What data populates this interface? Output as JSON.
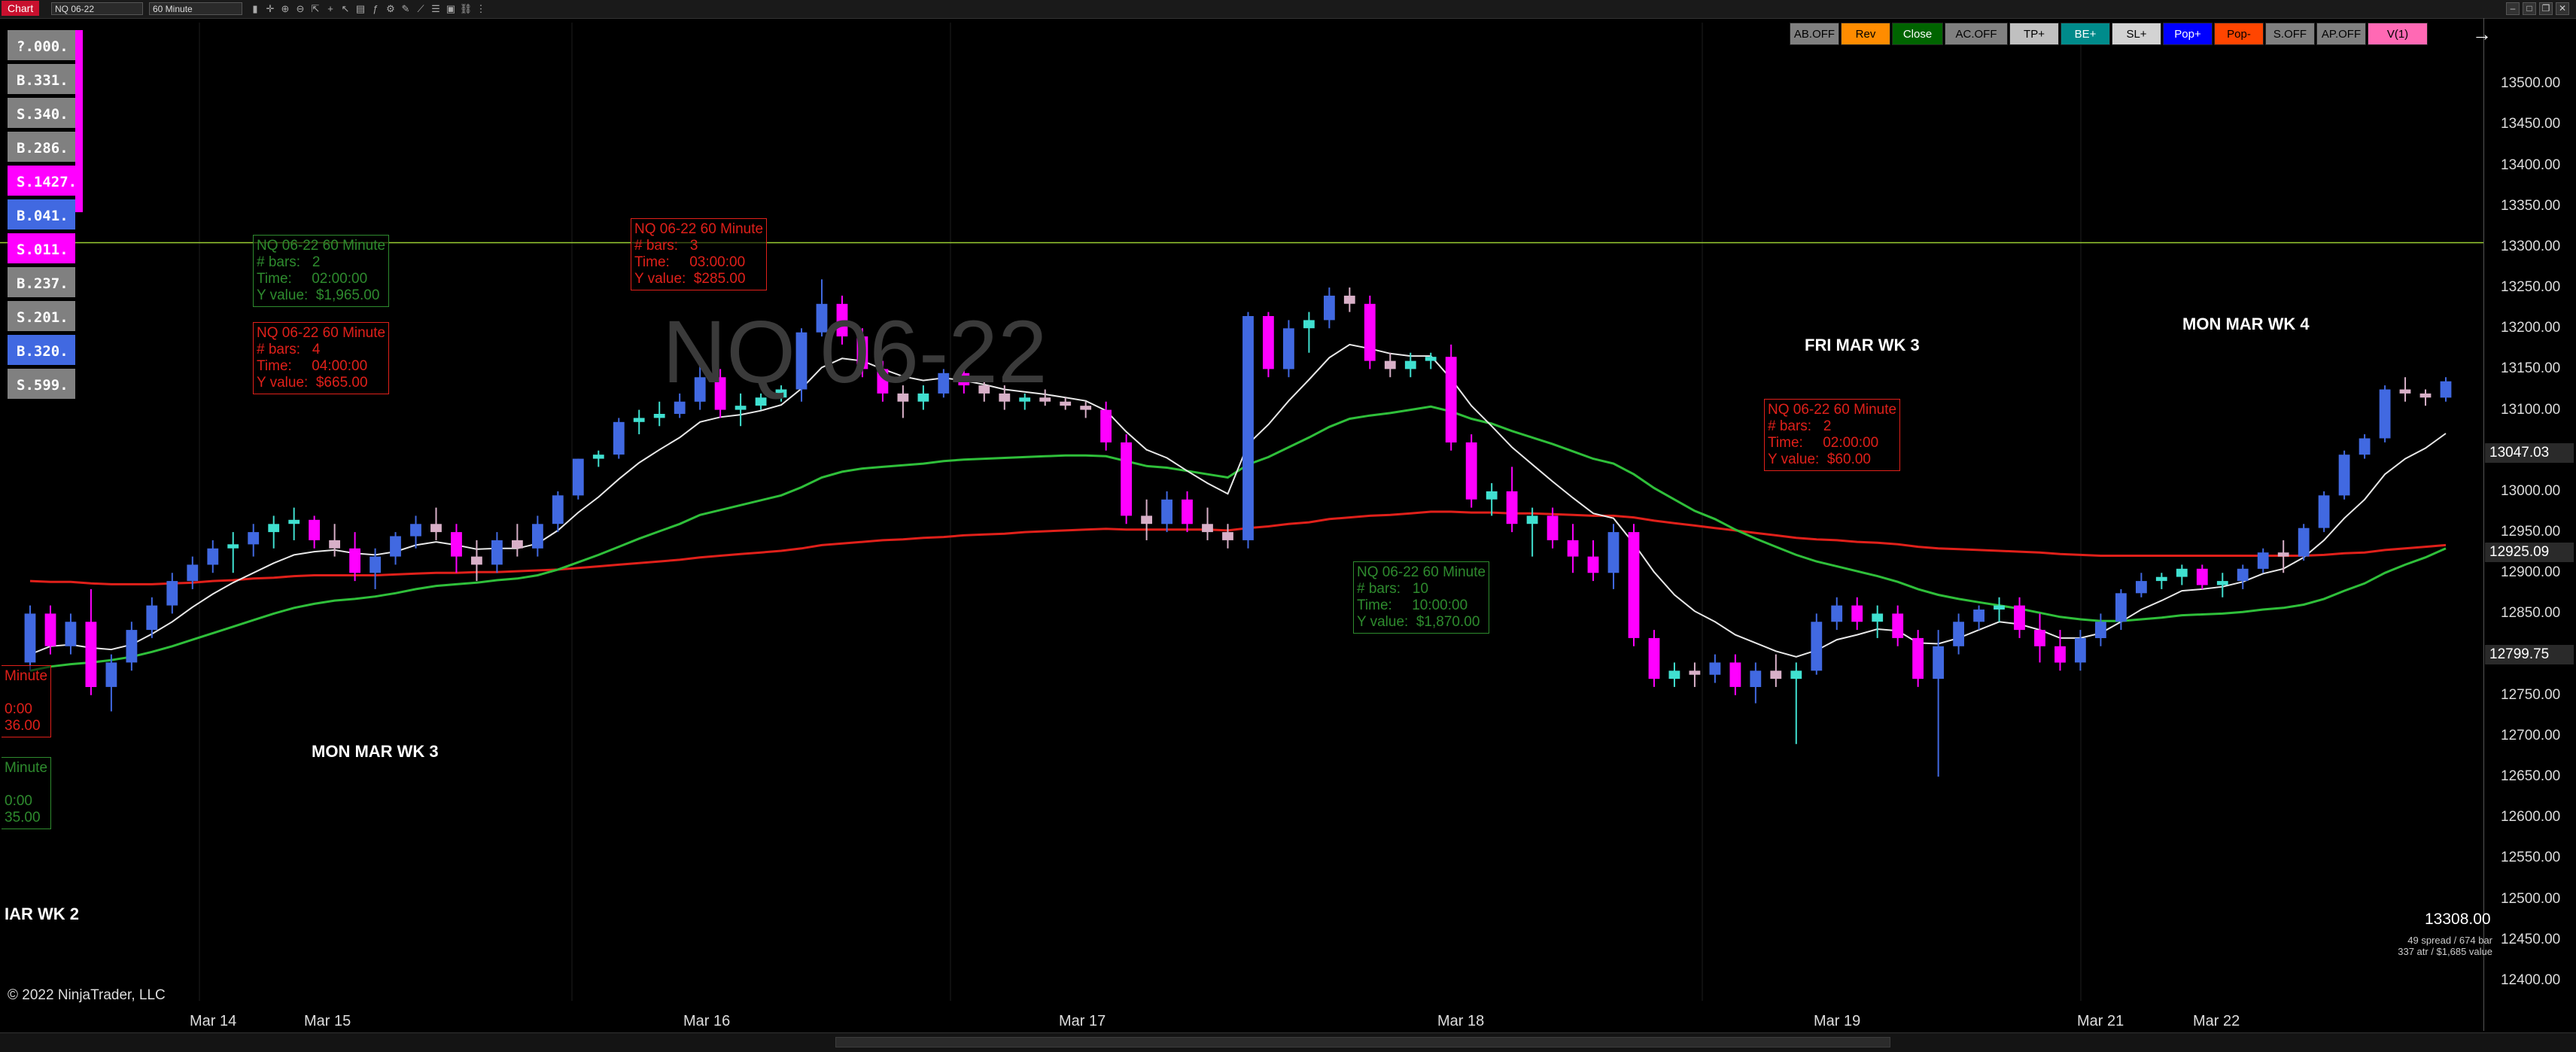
{
  "toolbar": {
    "tab_label": "Chart",
    "instrument": "NQ 06-22",
    "interval": "60 Minute"
  },
  "buttons": [
    {
      "label": "AB.OFF",
      "bg": "#808080",
      "fg": "#000000"
    },
    {
      "label": "Rev",
      "bg": "#ff8c00",
      "fg": "#000000"
    },
    {
      "label": "Close",
      "bg": "#006400",
      "fg": "#ffffff"
    },
    {
      "label": "AC.OFF",
      "bg": "#808080",
      "fg": "#000000"
    },
    {
      "label": "TP+",
      "bg": "#c0c0c0",
      "fg": "#000000"
    },
    {
      "label": "BE+",
      "bg": "#008b8b",
      "fg": "#ffffff"
    },
    {
      "label": "SL+",
      "bg": "#d3d3d3",
      "fg": "#000000"
    },
    {
      "label": "Pop+",
      "bg": "#0000ff",
      "fg": "#ffffff"
    },
    {
      "label": "Pop-",
      "bg": "#ff4500",
      "fg": "#000000"
    },
    {
      "label": "S.OFF",
      "bg": "#808080",
      "fg": "#000000"
    },
    {
      "label": "AP.OFF",
      "bg": "#808080",
      "fg": "#000000"
    },
    {
      "label": "V(1)",
      "bg": "#ff69b4",
      "fg": "#000000"
    }
  ],
  "order_ladder": [
    {
      "label": "?.000.",
      "bg": "#808080"
    },
    {
      "label": "B.331.",
      "bg": "#808080"
    },
    {
      "label": "S.340.",
      "bg": "#808080"
    },
    {
      "label": "B.286.",
      "bg": "#808080"
    },
    {
      "label": "S.1427.",
      "bg": "#ff00ff"
    },
    {
      "label": "B.041.",
      "bg": "#4169e1"
    },
    {
      "label": "S.011.",
      "bg": "#ff00ff"
    },
    {
      "label": "B.237.",
      "bg": "#808080"
    },
    {
      "label": "S.201.",
      "bg": "#808080"
    },
    {
      "label": "B.320.",
      "bg": "#4169e1"
    },
    {
      "label": "S.599.",
      "bg": "#808080"
    }
  ],
  "info_boxes": [
    {
      "lines": [
        "NQ 06-22 60 Minute",
        "# bars:   2",
        "Time:     02:00:00",
        "Y value:  $1,965.00"
      ],
      "color": "#2e8b2e"
    },
    {
      "lines": [
        "NQ 06-22 60 Minute",
        "# bars:   4",
        "Time:     04:00:00",
        "Y value:  $665.00"
      ],
      "color": "#e0201a"
    },
    {
      "lines": [
        "NQ 06-22 60 Minute",
        "# bars:   3",
        "Time:     03:00:00",
        "Y value:  $285.00"
      ],
      "color": "#e0201a"
    },
    {
      "lines": [
        "NQ 06-22 60 Minute",
        "# bars:   10",
        "Time:     10:00:00",
        "Y value:  $1,870.00"
      ],
      "color": "#2e8b2e"
    },
    {
      "lines": [
        "NQ 06-22 60 Minute",
        "# bars:   2",
        "Time:     02:00:00",
        "Y value:  $60.00"
      ],
      "color": "#e0201a"
    },
    {
      "lines": [
        "Minute",
        "",
        "0:00",
        "36.00"
      ],
      "color": "#e0201a"
    },
    {
      "lines": [
        "Minute",
        "",
        "0:00",
        "35.00"
      ],
      "color": "#2e8b2e"
    }
  ],
  "week_labels": [
    "MON MAR WK 3",
    "FRI MAR WK 3",
    "MON MAR WK 4",
    "IAR WK 2"
  ],
  "watermark": "NQ 06-22",
  "copyright": "© 2022 NinjaTrader, LLC",
  "stats": {
    "last_price": "13308.00",
    "line1": "49 spread / 674 bar",
    "line2": "337 atr / $1,685 value"
  },
  "price_flags": [
    {
      "label": "13047.03",
      "bg": "#2a2a2a",
      "fg": "#ffffff",
      "price": 13047.03
    },
    {
      "label": "12925.09",
      "bg": "#2a2a2a",
      "fg": "#ffffff",
      "price": 12925.09
    },
    {
      "label": "12799.75",
      "bg": "#2a2a2a",
      "fg": "#ffffff",
      "price": 12799.75
    }
  ],
  "chart_data": {
    "type": "candlestick",
    "instrument": "NQ 06-22",
    "interval": "60 Minute",
    "ylim": [
      12375,
      13575
    ],
    "y_ticks": [
      13500,
      13450,
      13400,
      13350,
      13300,
      13250,
      13200,
      13150,
      13100,
      13050,
      13000,
      12950,
      12900,
      12850,
      12800,
      12750,
      12700,
      12650,
      12600,
      12550,
      12500,
      12450,
      12400
    ],
    "x_labels": [
      "Mar 14",
      "Mar 15",
      "Mar 16",
      "Mar 17",
      "Mar 18",
      "Mar 19",
      "Mar 21",
      "Mar 22"
    ],
    "colors": {
      "up": "#4169e1",
      "down": "#ff00ff",
      "neutral": "#d8b0c8",
      "cyan": "#40e0d0",
      "ema_fast": "#e8e8e8",
      "ema_mid": "#2fbf3a",
      "ema_slow": "#e0201a",
      "level_line": "#9acd32"
    },
    "level_line": 13305,
    "candles": [
      [
        12790,
        12860,
        12780,
        12850
      ],
      [
        12850,
        12860,
        12800,
        12810
      ],
      [
        12810,
        12850,
        12800,
        12840
      ],
      [
        12840,
        12880,
        12750,
        12760
      ],
      [
        12760,
        12800,
        12730,
        12790
      ],
      [
        12790,
        12840,
        12780,
        12830
      ],
      [
        12830,
        12870,
        12820,
        12860
      ],
      [
        12860,
        12900,
        12850,
        12890
      ],
      [
        12890,
        12920,
        12880,
        12910
      ],
      [
        12910,
        12940,
        12900,
        12930
      ],
      [
        12930,
        12950,
        12900,
        12935
      ],
      [
        12935,
        12960,
        12920,
        12950
      ],
      [
        12950,
        12970,
        12930,
        12960
      ],
      [
        12960,
        12980,
        12940,
        12965
      ],
      [
        12965,
        12970,
        12930,
        12940
      ],
      [
        12940,
        12960,
        12920,
        12930
      ],
      [
        12930,
        12950,
        12890,
        12900
      ],
      [
        12900,
        12930,
        12880,
        12920
      ],
      [
        12920,
        12950,
        12910,
        12945
      ],
      [
        12945,
        12970,
        12930,
        12960
      ],
      [
        12960,
        12980,
        12940,
        12950
      ],
      [
        12950,
        12960,
        12900,
        12920
      ],
      [
        12920,
        12940,
        12890,
        12910
      ],
      [
        12910,
        12950,
        12900,
        12940
      ],
      [
        12940,
        12960,
        12920,
        12930
      ],
      [
        12930,
        12970,
        12920,
        12960
      ],
      [
        12960,
        13000,
        12950,
        12995
      ],
      [
        12995,
        13040,
        12990,
        13040
      ],
      [
        13040,
        13050,
        13030,
        13045
      ],
      [
        13045,
        13090,
        13040,
        13085
      ],
      [
        13085,
        13100,
        13070,
        13090
      ],
      [
        13090,
        13110,
        13080,
        13095
      ],
      [
        13095,
        13120,
        13090,
        13110
      ],
      [
        13110,
        13160,
        13100,
        13140
      ],
      [
        13140,
        13150,
        13090,
        13100
      ],
      [
        13100,
        13120,
        13080,
        13105
      ],
      [
        13105,
        13120,
        13100,
        13115
      ],
      [
        13115,
        13130,
        13110,
        13125
      ],
      [
        13125,
        13200,
        13110,
        13195
      ],
      [
        13195,
        13260,
        13190,
        13230
      ],
      [
        13230,
        13240,
        13180,
        13190
      ],
      [
        13190,
        13200,
        13140,
        13150
      ],
      [
        13150,
        13160,
        13110,
        13120
      ],
      [
        13120,
        13130,
        13090,
        13110
      ],
      [
        13110,
        13130,
        13100,
        13120
      ],
      [
        13120,
        13150,
        13115,
        13145
      ],
      [
        13145,
        13150,
        13120,
        13130
      ],
      [
        13130,
        13140,
        13110,
        13120
      ],
      [
        13120,
        13130,
        13100,
        13110
      ],
      [
        13110,
        13120,
        13100,
        13115
      ],
      [
        13115,
        13125,
        13105,
        13110
      ],
      [
        13110,
        13115,
        13100,
        13105
      ],
      [
        13105,
        13110,
        13090,
        13100
      ],
      [
        13100,
        13110,
        13050,
        13060
      ],
      [
        13060,
        13070,
        12960,
        12970
      ],
      [
        12970,
        12990,
        12940,
        12960
      ],
      [
        12960,
        13000,
        12950,
        12990
      ],
      [
        12990,
        13000,
        12950,
        12960
      ],
      [
        12960,
        12980,
        12940,
        12950
      ],
      [
        12950,
        12960,
        12930,
        12940
      ],
      [
        12940,
        13220,
        12930,
        13215
      ],
      [
        13215,
        13220,
        13140,
        13150
      ],
      [
        13150,
        13210,
        13140,
        13200
      ],
      [
        13200,
        13220,
        13170,
        13210
      ],
      [
        13210,
        13250,
        13200,
        13240
      ],
      [
        13240,
        13250,
        13220,
        13230
      ],
      [
        13230,
        13240,
        13150,
        13160
      ],
      [
        13160,
        13170,
        13140,
        13150
      ],
      [
        13150,
        13170,
        13140,
        13160
      ],
      [
        13160,
        13170,
        13150,
        13165
      ],
      [
        13165,
        13180,
        13050,
        13060
      ],
      [
        13060,
        13070,
        12980,
        12990
      ],
      [
        12990,
        13010,
        12970,
        13000
      ],
      [
        13000,
        13030,
        12950,
        12960
      ],
      [
        12960,
        12980,
        12920,
        12970
      ],
      [
        12970,
        12980,
        12930,
        12940
      ],
      [
        12940,
        12960,
        12900,
        12920
      ],
      [
        12920,
        12940,
        12890,
        12900
      ],
      [
        12900,
        12960,
        12880,
        12950
      ],
      [
        12950,
        12960,
        12810,
        12820
      ],
      [
        12820,
        12830,
        12760,
        12770
      ],
      [
        12770,
        12790,
        12760,
        12780
      ],
      [
        12780,
        12790,
        12760,
        12775
      ],
      [
        12775,
        12800,
        12765,
        12790
      ],
      [
        12790,
        12800,
        12750,
        12760
      ],
      [
        12760,
        12790,
        12740,
        12780
      ],
      [
        12780,
        12800,
        12760,
        12770
      ],
      [
        12770,
        12790,
        12690,
        12780
      ],
      [
        12780,
        12850,
        12775,
        12840
      ],
      [
        12840,
        12870,
        12830,
        12860
      ],
      [
        12860,
        12870,
        12830,
        12840
      ],
      [
        12840,
        12860,
        12820,
        12850
      ],
      [
        12850,
        12860,
        12810,
        12820
      ],
      [
        12820,
        12830,
        12760,
        12770
      ],
      [
        12770,
        12830,
        12650,
        12810
      ],
      [
        12810,
        12850,
        12800,
        12840
      ],
      [
        12840,
        12860,
        12830,
        12855
      ],
      [
        12855,
        12870,
        12840,
        12860
      ],
      [
        12860,
        12870,
        12820,
        12830
      ],
      [
        12830,
        12850,
        12790,
        12810
      ],
      [
        12810,
        12830,
        12780,
        12790
      ],
      [
        12790,
        12830,
        12780,
        12820
      ],
      [
        12820,
        12850,
        12810,
        12840
      ],
      [
        12840,
        12880,
        12830,
        12875
      ],
      [
        12875,
        12900,
        12870,
        12890
      ],
      [
        12890,
        12900,
        12880,
        12895
      ],
      [
        12895,
        12910,
        12885,
        12905
      ],
      [
        12905,
        12910,
        12880,
        12885
      ],
      [
        12885,
        12900,
        12870,
        12890
      ],
      [
        12890,
        12910,
        12880,
        12905
      ],
      [
        12905,
        12930,
        12900,
        12925
      ],
      [
        12925,
        12940,
        12900,
        12920
      ],
      [
        12920,
        12960,
        12915,
        12955
      ],
      [
        12955,
        13000,
        12950,
        12995
      ],
      [
        12995,
        13050,
        12990,
        13045
      ],
      [
        13045,
        13070,
        13040,
        13065
      ],
      [
        13065,
        13130,
        13060,
        13125
      ],
      [
        13125,
        13140,
        13110,
        13120
      ],
      [
        13120,
        13125,
        13105,
        13115
      ],
      [
        13115,
        13140,
        13110,
        13135
      ]
    ],
    "ema_fast": [
      12800,
      12810,
      12812,
      12808,
      12806,
      12812,
      12825,
      12840,
      12858,
      12874,
      12888,
      12900,
      12912,
      12922,
      12926,
      12928,
      12924,
      12922,
      12926,
      12934,
      12938,
      12934,
      12929,
      12930,
      12930,
      12936,
      12952,
      12974,
      12993,
      13015,
      13035,
      13051,
      13066,
      13085,
      13091,
      13094,
      13099,
      13106,
      13126,
      13152,
      13163,
      13160,
      13150,
      13141,
      13136,
      13139,
      13136,
      13131,
      13125,
      13122,
      13119,
      13115,
      13111,
      13099,
      13073,
      13051,
      13041,
      13025,
      13010,
      12997,
      13058,
      13082,
      13111,
      13137,
      13164,
      13180,
      13175,
      13169,
      13166,
      13166,
      13138,
      13105,
      13080,
      13054,
      13033,
      13012,
      12992,
      12973,
      12967,
      12936,
      12901,
      12873,
      12853,
      12840,
      12824,
      12814,
      12804,
      12797,
      12805,
      12818,
      12824,
      12831,
      12829,
      12814,
      12813,
      12820,
      12830,
      12840,
      12837,
      12830,
      12820,
      12820,
      12826,
      12840,
      12855,
      12866,
      12878,
      12880,
      12883,
      12889,
      12899,
      12905,
      12919,
      12940,
      12967,
      12990,
      13021,
      13040,
      13053,
      13071
    ],
    "ema_mid": [
      12780,
      12785,
      12788,
      12790,
      12793,
      12797,
      12803,
      12810,
      12818,
      12826,
      12834,
      12842,
      12850,
      12857,
      12862,
      12866,
      12868,
      12871,
      12875,
      12880,
      12884,
      12886,
      12888,
      12891,
      12893,
      12897,
      12904,
      12913,
      12922,
      12932,
      12942,
      12951,
      12960,
      12971,
      12977,
      12983,
      12989,
      12995,
      13005,
      13017,
      13024,
      13028,
      13030,
      13032,
      13034,
      13037,
      13039,
      13040,
      13041,
      13042,
      13043,
      13044,
      13044,
      13043,
      13037,
      13031,
      13029,
      13025,
      13021,
      13017,
      13033,
      13042,
      13054,
      13066,
      13079,
      13089,
      13093,
      13096,
      13100,
      13104,
      13098,
      13089,
      13083,
      13074,
      13066,
      13058,
      13049,
      13040,
      13034,
      13021,
      13004,
      12990,
      12976,
      12966,
      12953,
      12942,
      12932,
      12922,
      12914,
      12908,
      12902,
      12896,
      12889,
      12880,
      12873,
      12868,
      12864,
      12860,
      12856,
      12851,
      12846,
      12843,
      12841,
      12841,
      12843,
      12845,
      12848,
      12849,
      12850,
      12852,
      12855,
      12857,
      12861,
      12868,
      12878,
      12887,
      12900,
      12910,
      12919,
      12930
    ],
    "ema_slow": [
      12890,
      12889,
      12889,
      12887,
      12886,
      12886,
      12886,
      12887,
      12888,
      12890,
      12891,
      12893,
      12894,
      12896,
      12897,
      12897,
      12897,
      12897,
      12898,
      12899,
      12900,
      12900,
      12901,
      12901,
      12902,
      12903,
      12904,
      12906,
      12908,
      12910,
      12912,
      12914,
      12916,
      12919,
      12921,
      12923,
      12925,
      12927,
      12930,
      12934,
      12936,
      12938,
      12940,
      12941,
      12943,
      12944,
      12946,
      12947,
      12948,
      12950,
      12951,
      12952,
      12953,
      12954,
      12953,
      12953,
      12953,
      12953,
      12953,
      12952,
      12955,
      12957,
      12960,
      12962,
      12966,
      12968,
      12970,
      12971,
      12973,
      12975,
      12975,
      12974,
      12974,
      12973,
      12973,
      12972,
      12971,
      12970,
      12970,
      12968,
      12964,
      12961,
      12958,
      12955,
      12952,
      12949,
      12946,
      12943,
      12941,
      12940,
      12938,
      12937,
      12935,
      12932,
      12930,
      12929,
      12928,
      12927,
      12926,
      12925,
      12923,
      12922,
      12921,
      12921,
      12921,
      12921,
      12921,
      12921,
      12921,
      12921,
      12921,
      12921,
      12921,
      12922,
      12924,
      12925,
      12928,
      12930,
      12932,
      12934
    ]
  }
}
